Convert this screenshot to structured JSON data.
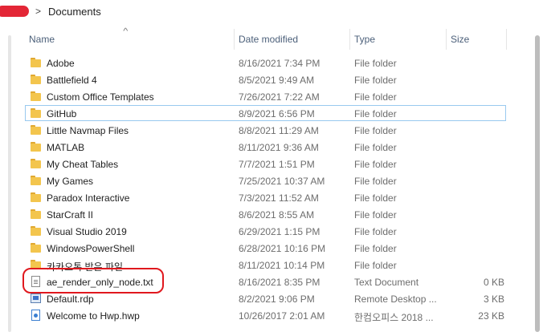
{
  "address": {
    "separator": ">",
    "path": "Documents"
  },
  "columns": {
    "name": "Name",
    "date": "Date modified",
    "type": "Type",
    "size": "Size"
  },
  "rows": [
    {
      "name": "Adobe",
      "date": "8/16/2021 7:34 PM",
      "type": "File folder",
      "size": "",
      "icon": "folder-icon"
    },
    {
      "name": "Battlefield 4",
      "date": "8/5/2021 9:49 AM",
      "type": "File folder",
      "size": "",
      "icon": "folder-icon"
    },
    {
      "name": "Custom Office Templates",
      "date": "7/26/2021 7:22 AM",
      "type": "File folder",
      "size": "",
      "icon": "folder-icon"
    },
    {
      "name": "GitHub",
      "date": "8/9/2021 6:56 PM",
      "type": "File folder",
      "size": "",
      "icon": "folder-icon"
    },
    {
      "name": "Little Navmap Files",
      "date": "8/8/2021 11:29 AM",
      "type": "File folder",
      "size": "",
      "icon": "folder-icon"
    },
    {
      "name": "MATLAB",
      "date": "8/11/2021 9:36 AM",
      "type": "File folder",
      "size": "",
      "icon": "folder-icon"
    },
    {
      "name": "My Cheat Tables",
      "date": "7/7/2021 1:51 PM",
      "type": "File folder",
      "size": "",
      "icon": "folder-icon"
    },
    {
      "name": "My Games",
      "date": "7/25/2021 10:37 AM",
      "type": "File folder",
      "size": "",
      "icon": "folder-icon"
    },
    {
      "name": "Paradox Interactive",
      "date": "7/3/2021 11:52 AM",
      "type": "File folder",
      "size": "",
      "icon": "folder-icon"
    },
    {
      "name": "StarCraft II",
      "date": "8/6/2021 8:55 AM",
      "type": "File folder",
      "size": "",
      "icon": "folder-icon"
    },
    {
      "name": "Visual Studio 2019",
      "date": "6/29/2021 1:15 PM",
      "type": "File folder",
      "size": "",
      "icon": "folder-icon"
    },
    {
      "name": "WindowsPowerShell",
      "date": "6/28/2021 10:16 PM",
      "type": "File folder",
      "size": "",
      "icon": "folder-icon"
    },
    {
      "name": "카카오톡 받은 파일",
      "date": "8/11/2021 10:14 PM",
      "type": "File folder",
      "size": "",
      "icon": "folder-icon"
    },
    {
      "name": "ae_render_only_node.txt",
      "date": "8/16/2021 8:35 PM",
      "type": "Text Document",
      "size": "0 KB",
      "icon": "text-document-icon"
    },
    {
      "name": "Default.rdp",
      "date": "8/2/2021 9:06 PM",
      "type": "Remote Desktop ...",
      "size": "3 KB",
      "icon": "remote-desktop-icon"
    },
    {
      "name": "Welcome to Hwp.hwp",
      "date": "10/26/2017 2:01 AM",
      "type": "한컴오피스 2018 ...",
      "size": "23 KB",
      "icon": "hwp-document-icon"
    }
  ],
  "focused_row": 3,
  "colors": {
    "highlight_outline": "#e0181e",
    "focus_border": "#99c9ef",
    "folder": "#f3c54d"
  }
}
